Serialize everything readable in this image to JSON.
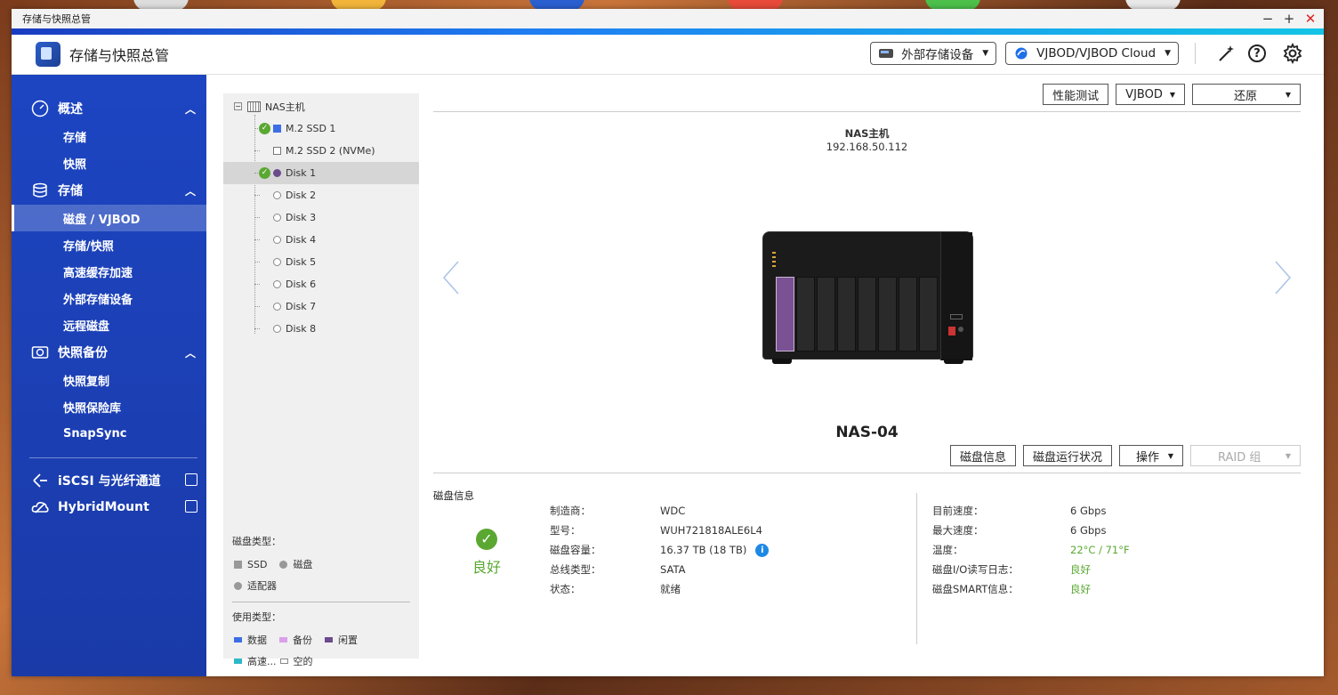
{
  "window": {
    "title": "存储与快照总管"
  },
  "app": {
    "title": "存储与快照总管"
  },
  "header": {
    "external_storage": "外部存储设备",
    "vjbod_cloud": "VJBOD/VJBOD Cloud"
  },
  "sidebar": {
    "groups": [
      {
        "label": "概述",
        "items": [
          "存储",
          "快照"
        ]
      },
      {
        "label": "存储",
        "items": [
          "磁盘 / VJBOD",
          "存储/快照",
          "高速缓存加速",
          "外部存储设备",
          "远程磁盘"
        ]
      },
      {
        "label": "快照备份",
        "items": [
          "快照复制",
          "快照保险库",
          "SnapSync"
        ]
      }
    ],
    "links": [
      "iSCSI 与光纤通道",
      "HybridMount"
    ],
    "active_item": "磁盘 / VJBOD"
  },
  "tree": {
    "root": "NAS主机",
    "nodes": [
      "M.2 SSD 1",
      "M.2 SSD 2 (NVMe)",
      "Disk 1",
      "Disk 2",
      "Disk 3",
      "Disk 4",
      "Disk 5",
      "Disk 6",
      "Disk 7",
      "Disk 8"
    ],
    "selected": "Disk 1"
  },
  "legend": {
    "disk_type_title": "磁盘类型：",
    "disk_types": [
      "SSD",
      "磁盘",
      "适配器"
    ],
    "usage_title": "使用类型：",
    "usage_types": [
      "数据",
      "备份",
      "闲置",
      "高速...",
      "空的"
    ],
    "colors": {
      "data": "#3b6ee6",
      "backup": "#d9a0e8",
      "idle": "#6b4b8c",
      "cache": "#2fb8c8"
    }
  },
  "toolbar": {
    "perf_test": "性能测试",
    "vjbod": "VJBOD",
    "restore": "还原"
  },
  "device": {
    "name": "NAS主机",
    "ip": "192.168.50.112",
    "model": "NAS-04"
  },
  "toolbar2": {
    "disk_info": "磁盘信息",
    "disk_health": "磁盘运行状况",
    "actions": "操作",
    "raid_group": "RAID 组"
  },
  "info": {
    "title": "磁盘信息",
    "health": "良好",
    "left": [
      {
        "k": "制造商：",
        "v": "WDC"
      },
      {
        "k": "型号：",
        "v": "WUH721818ALE6L4"
      },
      {
        "k": "磁盘容量：",
        "v": "16.37 TB (18 TB)"
      },
      {
        "k": "总线类型：",
        "v": "SATA"
      },
      {
        "k": "状态：",
        "v": "就绪"
      }
    ],
    "right": [
      {
        "k": "目前速度：",
        "v": "6 Gbps"
      },
      {
        "k": "最大速度：",
        "v": "6 Gbps"
      },
      {
        "k": "温度：",
        "v": "22°C / 71°F"
      },
      {
        "k": "磁盘I/O读写日志：",
        "v": "良好"
      },
      {
        "k": "磁盘SMART信息：",
        "v": "良好"
      }
    ]
  },
  "colors": {
    "accent": "#1d45c2",
    "ok": "#5aa832",
    "selected_bay": "#7a5294"
  }
}
